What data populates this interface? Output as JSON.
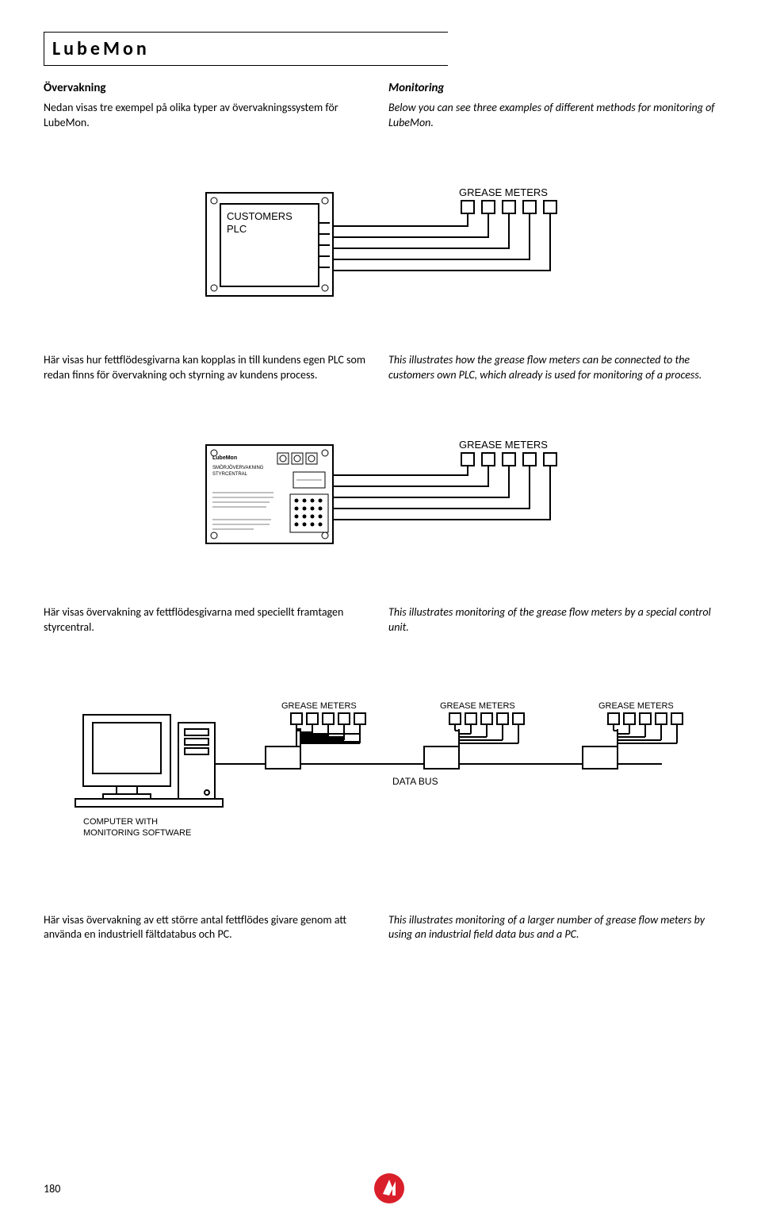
{
  "title": "LubeMon",
  "intro": {
    "heading_sv": "Övervakning",
    "heading_en": "Monitoring",
    "text_sv": "Nedan visas tre exempel på olika typer av övervakningssystem för LubeMon.",
    "text_en": "Below you can see three examples of different methods for monitoring of LubeMon."
  },
  "d1": {
    "box_label1": "CUSTOMERS",
    "box_label2": "PLC",
    "meters_label": "GREASE METERS",
    "caption_sv": "Här visas hur fettflödesgivarna kan kopplas in till kundens egen PLC som redan finns för övervakning och styrning av kundens process.",
    "caption_en": "This illustrates how the grease flow meters can be connected to the customers own PLC, which already is used for monitoring of a process."
  },
  "d2": {
    "panel_title": "LubeMon",
    "panel_sub1": "SMÖRJÖVERVAKNING",
    "panel_sub2": "STYRCENTRAL",
    "meters_label": "GREASE METERS",
    "caption_sv": "Här visas övervakning av fettflödesgivarna med speciellt framtagen styrcentral.",
    "caption_en": "This illustrates monitoring of the grease flow meters  by a special control unit."
  },
  "d3": {
    "meters_label": "GREASE METERS",
    "bus_label": "DATA BUS",
    "pc_label1": "COMPUTER WITH",
    "pc_label2": "MONITORING SOFTWARE",
    "caption_sv": "Här visas övervakning av ett större antal fettflödes givare genom att använda en industriell fältdatabus och PC.",
    "caption_en": "This illustrates monitoring of a larger number of grease flow meters by using an industrial field data bus and a PC."
  },
  "page_number": "180"
}
